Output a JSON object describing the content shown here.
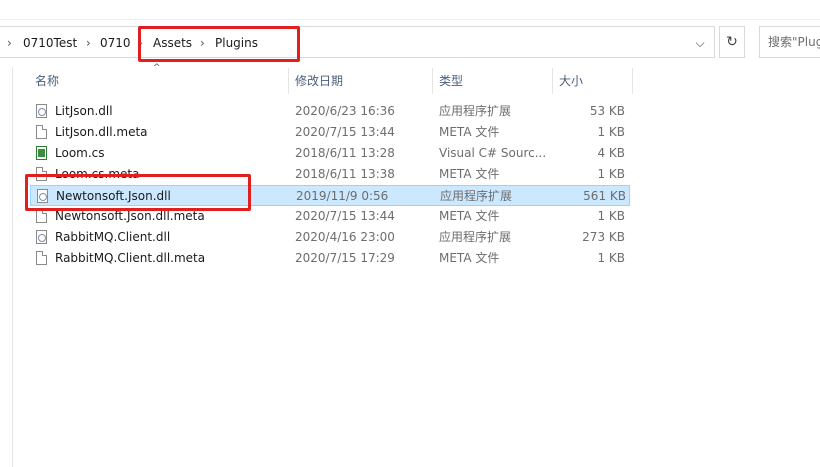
{
  "breadcrumb": {
    "items": [
      "0710Test",
      "0710",
      "Assets",
      "Plugins"
    ],
    "separator": "›"
  },
  "address_bar": {
    "dropdown_icon": "chevron-down-icon",
    "refresh_icon": "refresh-icon",
    "refresh_glyph": "↻",
    "dropdown_glyph": "⌵"
  },
  "search": {
    "placeholder": "搜索\"Plug"
  },
  "columns": {
    "name": "名称",
    "date": "修改日期",
    "type": "类型",
    "size": "大小",
    "sort_glyph": "^"
  },
  "files": [
    {
      "name": "LitJson.dll",
      "date": "2020/6/23 16:36",
      "type": "应用程序扩展",
      "size": "53 KB",
      "icon": "dll-file-icon"
    },
    {
      "name": "LitJson.dll.meta",
      "date": "2020/7/15 13:44",
      "type": "META 文件",
      "size": "1 KB",
      "icon": "file-icon"
    },
    {
      "name": "Loom.cs",
      "date": "2018/6/11 13:28",
      "type": "Visual C# Sourc...",
      "size": "4 KB",
      "icon": "csharp-file-icon"
    },
    {
      "name": "Loom.cs.meta",
      "date": "2018/6/11 13:38",
      "type": "META 文件",
      "size": "1 KB",
      "icon": "file-icon"
    },
    {
      "name": "Newtonsoft.Json.dll",
      "date": "2019/11/9 0:56",
      "type": "应用程序扩展",
      "size": "561 KB",
      "icon": "dll-file-icon",
      "selected": true
    },
    {
      "name": "Newtonsoft.Json.dll.meta",
      "date": "2020/7/15 13:44",
      "type": "META 文件",
      "size": "1 KB",
      "icon": "file-icon"
    },
    {
      "name": "RabbitMQ.Client.dll",
      "date": "2020/4/16 23:00",
      "type": "应用程序扩展",
      "size": "273 KB",
      "icon": "dll-file-icon"
    },
    {
      "name": "RabbitMQ.Client.dll.meta",
      "date": "2020/7/15 17:29",
      "type": "META 文件",
      "size": "1 KB",
      "icon": "file-icon"
    }
  ],
  "colors": {
    "highlight": "#e0201e",
    "selection": "#cce8ff",
    "header_text": "#4c607a"
  }
}
